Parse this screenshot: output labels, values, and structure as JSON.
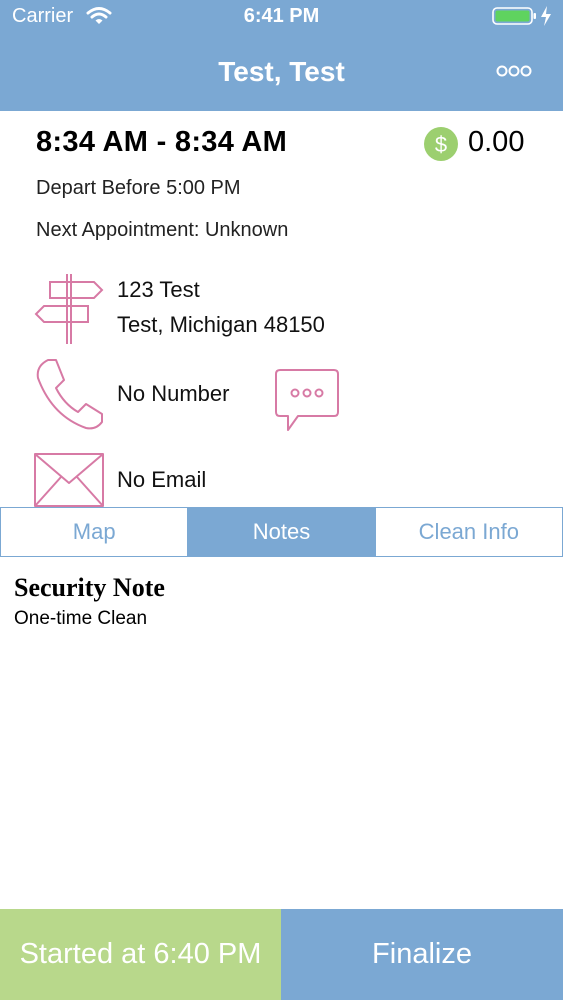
{
  "status_bar": {
    "carrier": "Carrier",
    "time": "6:41 PM"
  },
  "nav": {
    "title": "Test, Test"
  },
  "appointment": {
    "time_range": "8:34 AM - 8:34 AM",
    "price": "0.00",
    "depart": "Depart Before 5:00 PM",
    "next_appointment": "Next Appointment: Unknown"
  },
  "contact": {
    "address_line1": "123 Test",
    "address_line2": "Test, Michigan 48150",
    "phone": "No Number",
    "email": "No Email"
  },
  "tabs": [
    {
      "label": "Map",
      "active": false
    },
    {
      "label": "Notes",
      "active": true
    },
    {
      "label": "Clean Info",
      "active": false
    }
  ],
  "notes": {
    "title": "Security Note",
    "body": "One-time Clean"
  },
  "actions": {
    "started": "Started at 6:40 PM",
    "finalize": "Finalize"
  },
  "icons": {
    "wifi": "wifi-icon",
    "battery": "battery-icon",
    "charging": "charging-bolt-icon",
    "more": "more-options-icon",
    "dollar": "dollar-icon",
    "signpost": "signpost-icon",
    "phone": "phone-icon",
    "message": "message-bubble-icon",
    "mail": "envelope-icon"
  },
  "colors": {
    "header": "#7ba8d3",
    "accent": "#7ba8d3",
    "icon_pink": "#d77aa5",
    "dollar_green": "#9ccf6f",
    "started_green": "#b8d88b",
    "battery_green": "#5fd35f"
  }
}
